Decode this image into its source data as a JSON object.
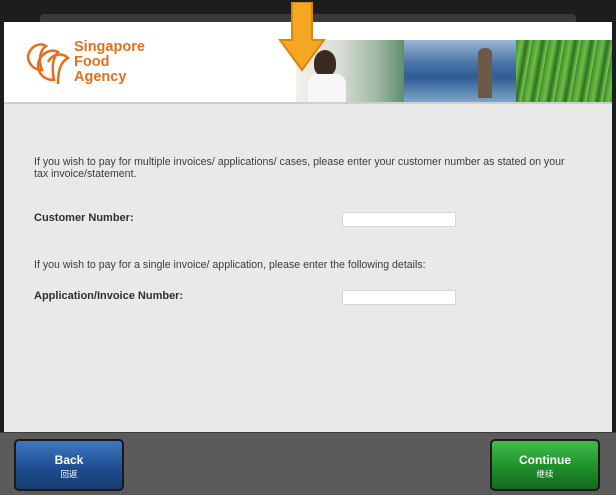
{
  "brand": {
    "logo_lines": [
      "Singapore",
      "Food",
      "Agency"
    ],
    "accent_color": "#e36f1e"
  },
  "header": {
    "banner_photos": [
      "lab-scientist-photo",
      "fish-farm-photo",
      "vegetable-field-photo"
    ],
    "pointer_arrow_icon": "down-arrow-icon",
    "pointer_arrow_color": "#f5a623"
  },
  "form": {
    "multi_intro": "If you wish to pay for multiple invoices/ applications/ cases, please enter your customer number as stated on your tax invoice/statement.",
    "customer_number_label": "Customer Number:",
    "customer_number_value": "",
    "single_intro": "If you wish to pay for a single invoice/ application, please enter the following details:",
    "application_number_label": "Application/Invoice Number:",
    "application_number_value": ""
  },
  "footer": {
    "back_label": "Back",
    "back_sub_label": "回返",
    "continue_label": "Continue",
    "continue_sub_label": "继续",
    "back_color": "#1f4f91",
    "continue_color": "#1f8f2b"
  }
}
